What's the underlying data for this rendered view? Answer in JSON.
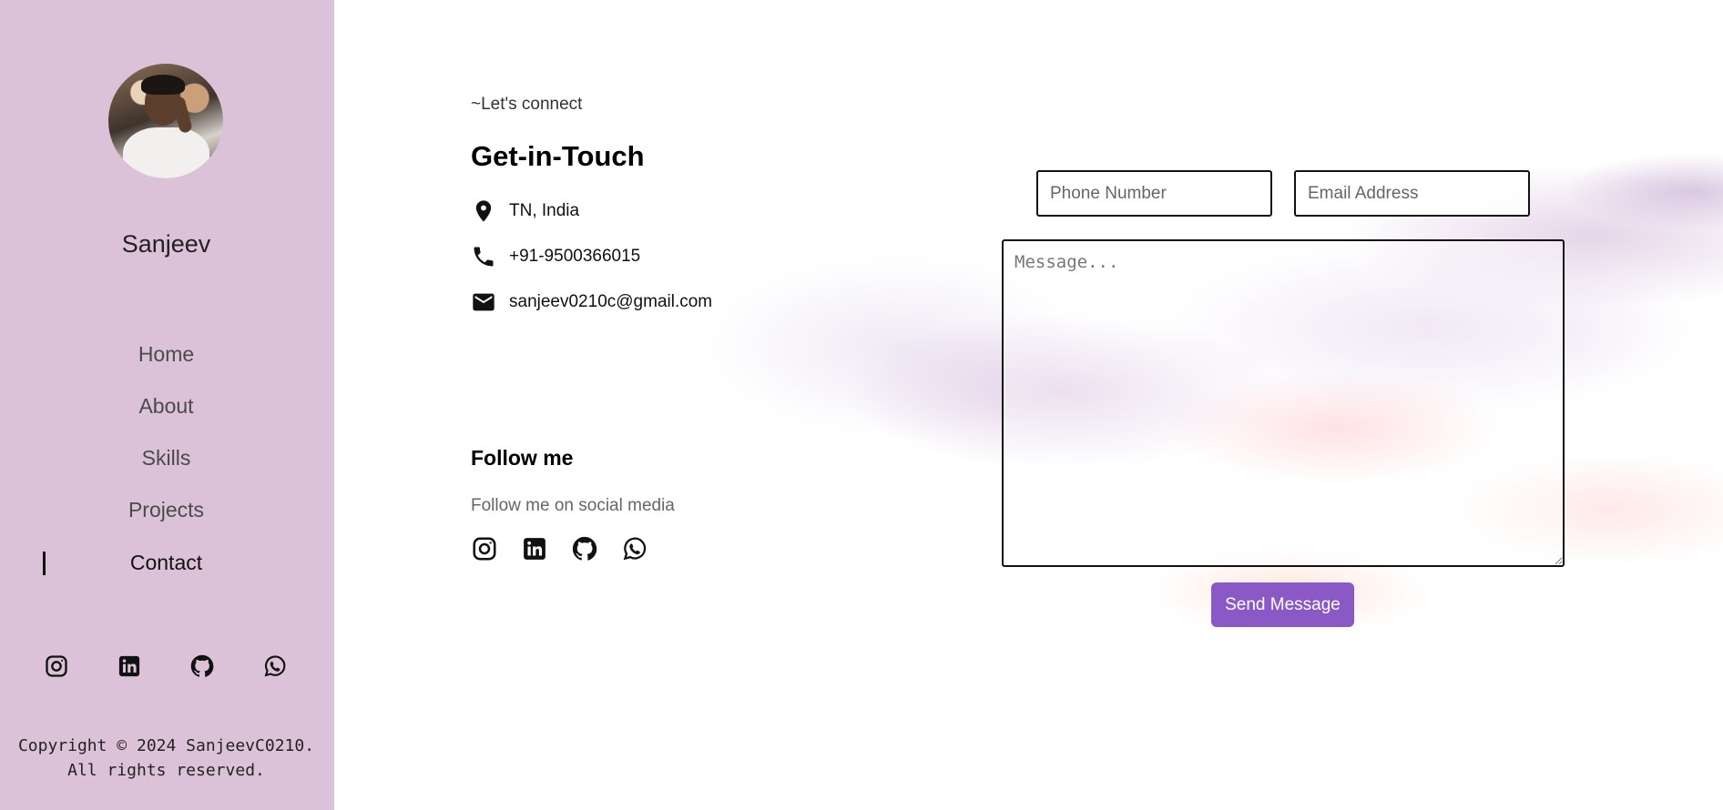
{
  "sidebar": {
    "name": "Sanjeev",
    "nav": [
      {
        "label": "Home"
      },
      {
        "label": "About"
      },
      {
        "label": "Skills"
      },
      {
        "label": "Projects"
      },
      {
        "label": "Contact",
        "active": true
      }
    ],
    "social_icons": [
      "instagram-icon",
      "linkedin-icon",
      "github-icon",
      "whatsapp-icon"
    ],
    "copyright": "Copyright © 2024 SanjeevC0210. All rights reserved."
  },
  "contact": {
    "tagline": "~Let's connect",
    "heading": "Get-in-Touch",
    "location": "TN, India",
    "phone": "+91-9500366015",
    "email": "sanjeev0210c@gmail.com"
  },
  "follow": {
    "title": "Follow me",
    "subtitle": "Follow me on social media",
    "social_icons": [
      "instagram-icon",
      "linkedin-icon",
      "github-icon",
      "whatsapp-icon"
    ]
  },
  "form": {
    "phone_placeholder": "Phone Number",
    "email_placeholder": "Email Address",
    "message_placeholder": "Message...",
    "submit_label": "Send Message"
  },
  "colors": {
    "sidebar_bg": "#dcc2d8",
    "button_bg": "#8b59c6"
  }
}
